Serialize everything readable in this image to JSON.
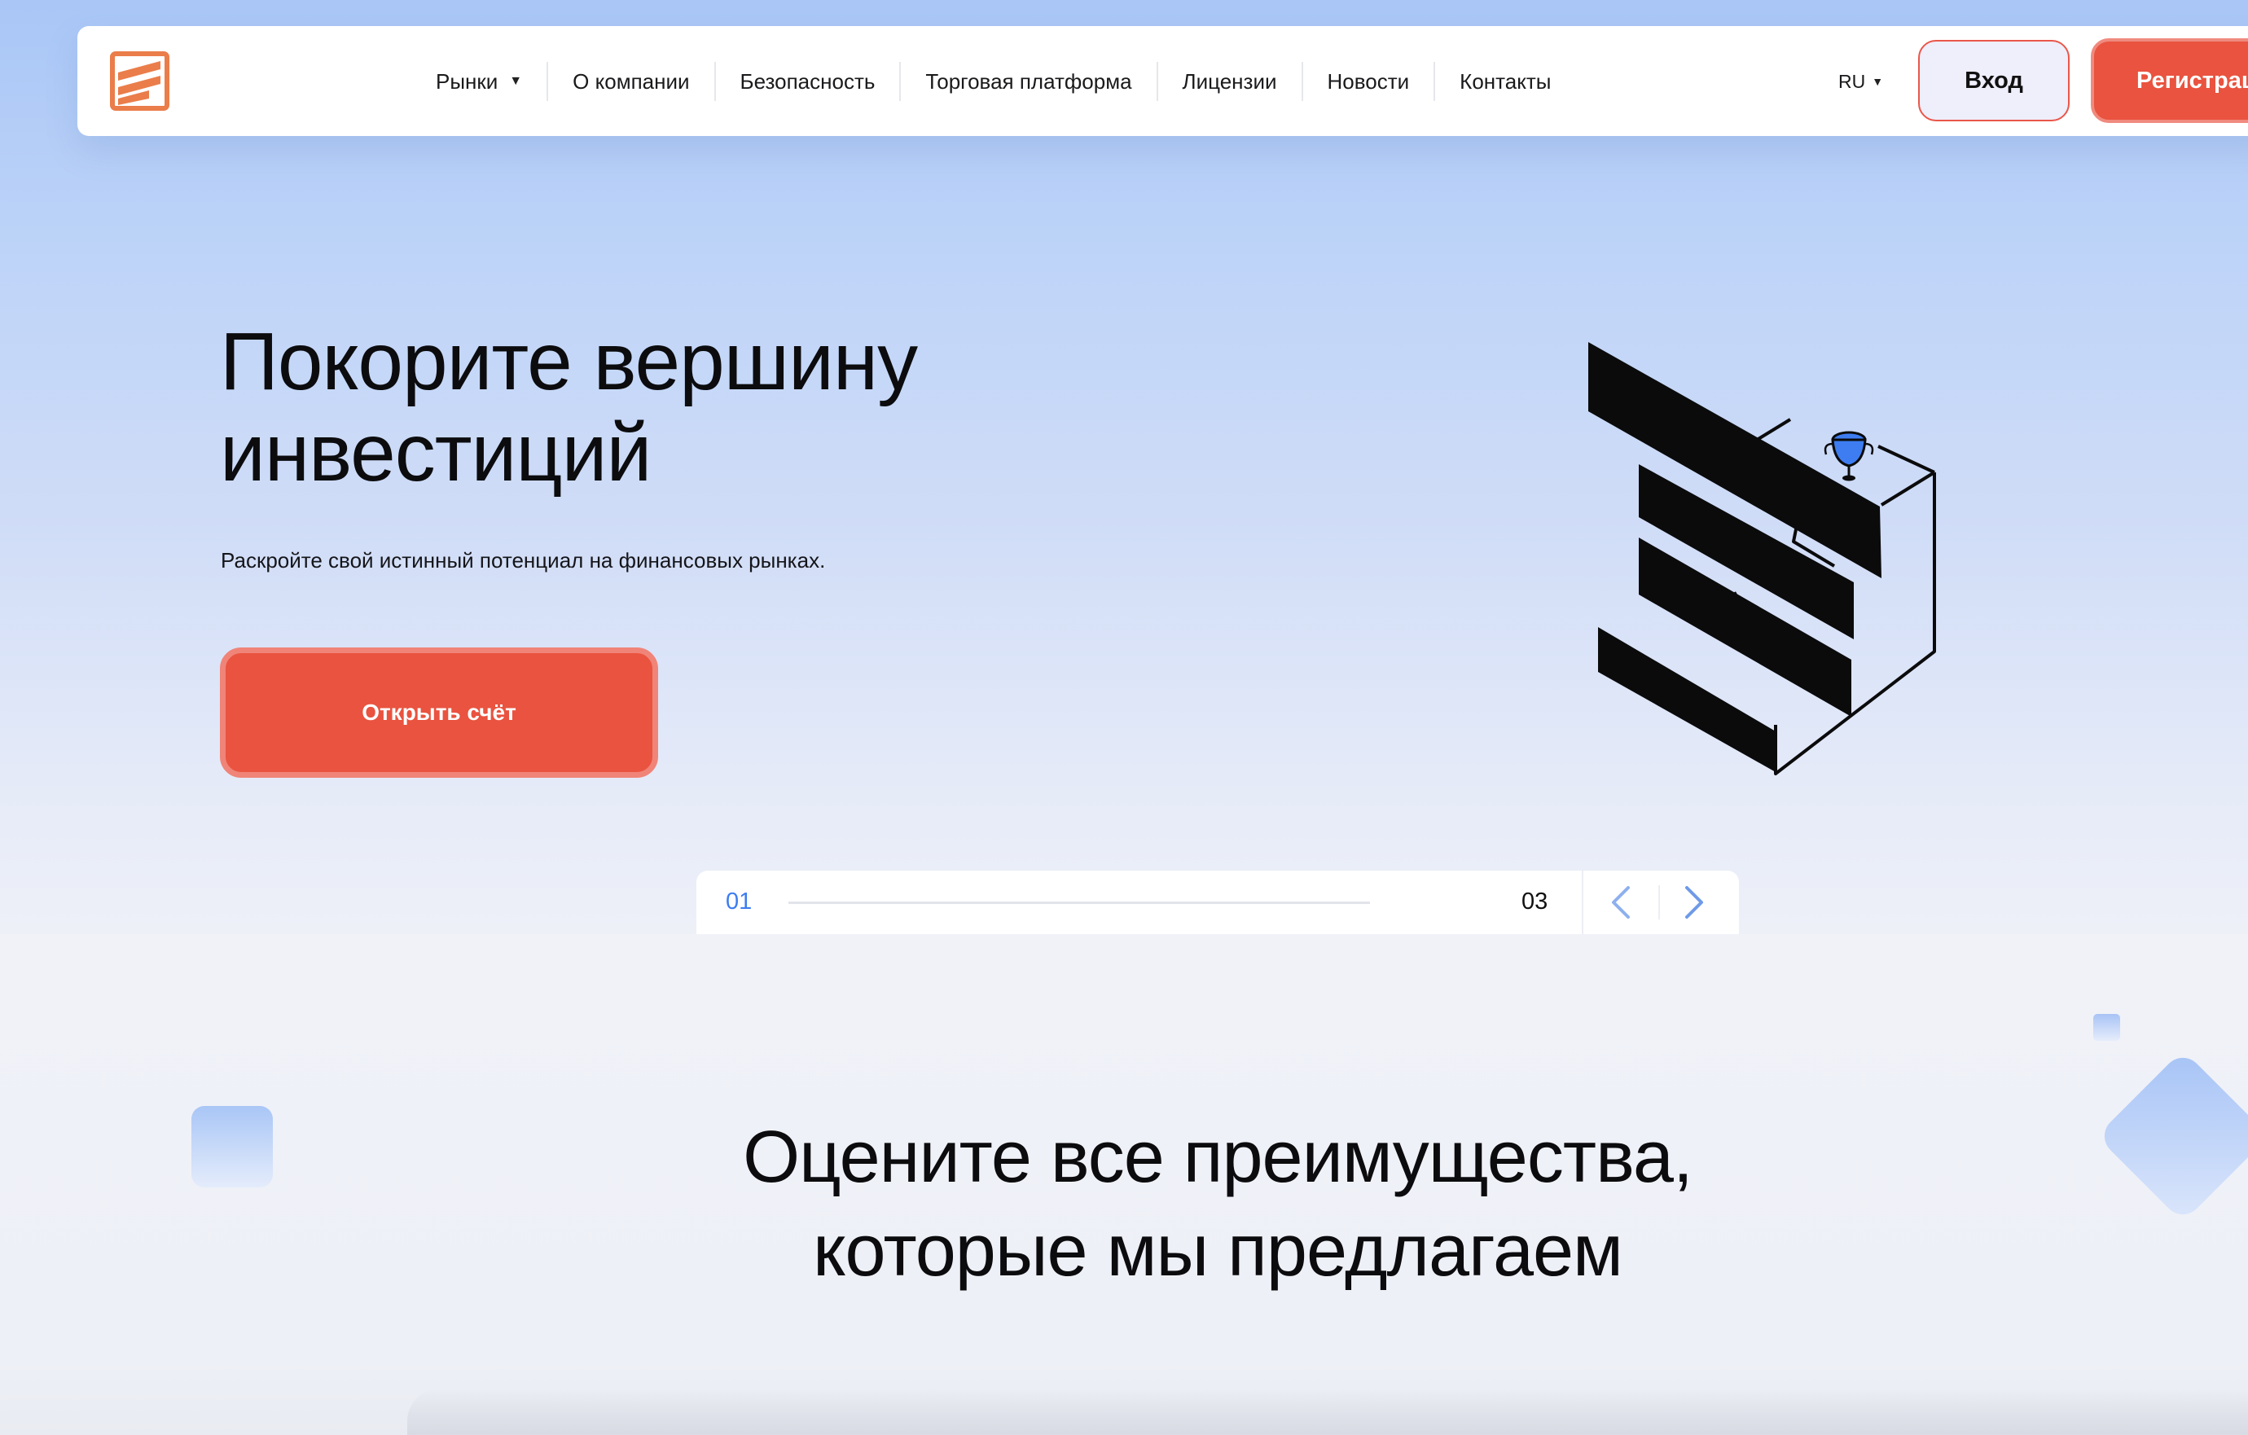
{
  "nav": {
    "logo": "brand-logo",
    "items": [
      {
        "label": "Рынки",
        "has_caret": true
      },
      {
        "label": "О компании"
      },
      {
        "label": "Безопасность"
      },
      {
        "label": "Торговая платформа"
      },
      {
        "label": "Лицензии"
      },
      {
        "label": "Новости"
      },
      {
        "label": "Контакты"
      }
    ],
    "language": "RU",
    "login_label": "Вход",
    "register_label": "Регистрация"
  },
  "hero": {
    "title": "Покорите вершину инвестиций",
    "subtitle": "Раскройте свой истинный потенциал на финансовых рынках.",
    "cta_label": "Открыть счёт",
    "illustration": "stairs-with-trophy"
  },
  "slider": {
    "current": "01",
    "total": "03",
    "progress": 0,
    "prev_icon": "chevron-left-icon",
    "next_icon": "chevron-right-icon"
  },
  "benefits": {
    "title": "Оцените все преимущества, которые мы предлагаем"
  },
  "colors": {
    "accent": "#e9533f",
    "accent_border": "#f08478",
    "link_blue": "#3d7df1",
    "hero_gradient_top": "#a9c6f6",
    "hero_gradient_bottom": "#eef0f8"
  }
}
